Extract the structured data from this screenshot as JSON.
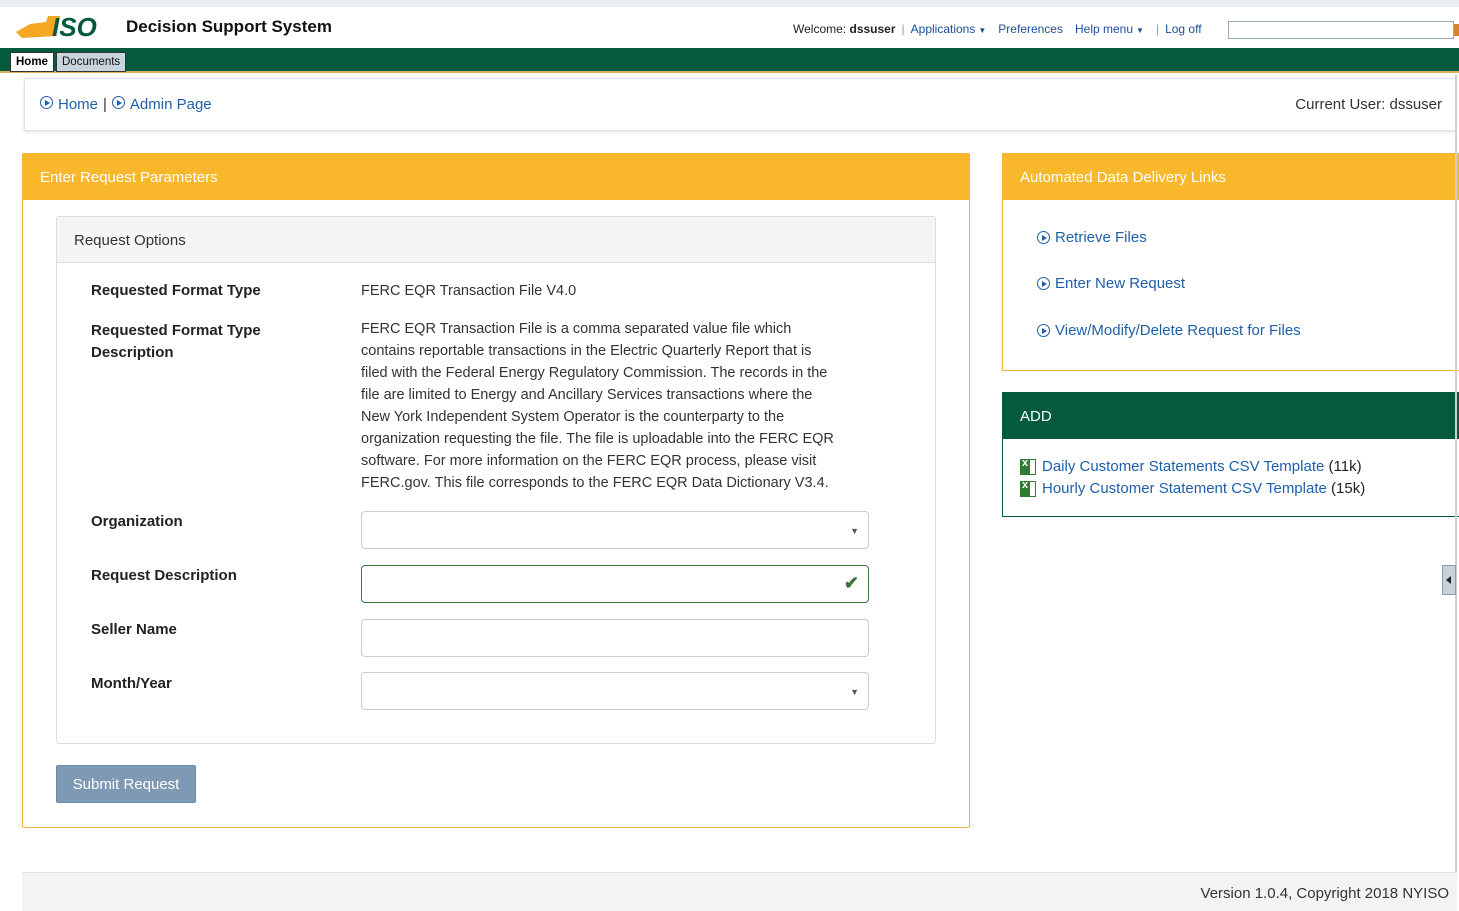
{
  "header": {
    "app_title": "Decision Support System",
    "welcome_prefix": "Welcome:",
    "username": "dssuser",
    "menu": {
      "applications": "Applications",
      "preferences": "Preferences",
      "help": "Help menu",
      "logoff": "Log off"
    },
    "search_value": ""
  },
  "tabs": [
    {
      "label": "Home",
      "active": true
    },
    {
      "label": "Documents",
      "active": false
    }
  ],
  "breadcrumb": {
    "home": "Home",
    "admin": "Admin Page",
    "current_user": "Current User: dssuser"
  },
  "request_panel": {
    "title": "Enter Request Parameters",
    "options_title": "Request Options",
    "format_type_label": "Requested Format Type",
    "format_type_value": "FERC EQR Transaction File V4.0",
    "format_desc_label_1": "Requested Format Type",
    "format_desc_label_2": "Description",
    "format_desc_lines": [
      "FERC EQR Transaction File is a comma separated value file which",
      "contains reportable transactions in the Electric Quarterly Report that is",
      "filed with the Federal Energy Regulatory Commission. The records in the",
      "file are limited to Energy and Ancillary Services transactions where the",
      "New York Independent System Operator is the counterparty to the",
      "organization requesting the file. The file is uploadable into the FERC EQR",
      "software. For more information on the FERC EQR process, please visit",
      "FERC.gov. This file corresponds to the FERC EQR Data Dictionary V3.4."
    ],
    "fields": {
      "organization": {
        "label": "Organization",
        "value": ""
      },
      "request_description": {
        "label": "Request Description",
        "value": ""
      },
      "seller_name": {
        "label": "Seller Name",
        "value": ""
      },
      "month_year": {
        "label": "Month/Year",
        "value": ""
      }
    },
    "submit_label": "Submit Request"
  },
  "automated_panel": {
    "title": "Automated Data Delivery Links",
    "links": [
      "Retrieve Files",
      "Enter New Request",
      "View/Modify/Delete Request for Files"
    ]
  },
  "add_panel": {
    "title": "ADD",
    "files": [
      {
        "name": "Daily Customer Statements CSV Template",
        "size": "(11k)"
      },
      {
        "name": "Hourly Customer Statement CSV Template",
        "size": "(15k)"
      }
    ]
  },
  "footer": {
    "text": "Version 1.0.4, Copyright 2018 NYISO"
  },
  "colors": {
    "accent_orange": "#f9b72b",
    "brand_green": "#035a3d",
    "link_blue": "#1f5fa8",
    "valid_green": "#3c763d"
  }
}
